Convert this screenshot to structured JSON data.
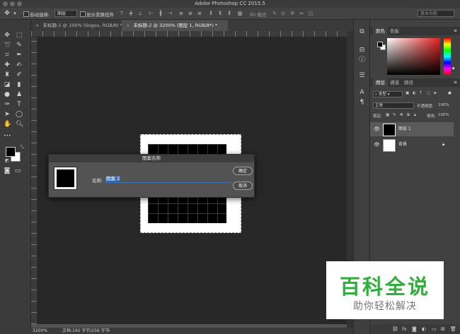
{
  "app": {
    "title": "Adobe Photoshop CC 2015.5"
  },
  "options_bar": {
    "auto_select_label": "自动选择:",
    "auto_select_value": "图层",
    "transform_label": "显示变换控件",
    "mode_3d_label": "3D 模式:",
    "search_placeholder": "基本功能"
  },
  "tabs": [
    {
      "label": "未标题-1 @ 100% (Sogou, RGB/8) *"
    },
    {
      "label": "未标题-2 @ 3200% (图层 1, RGB/8*) *"
    }
  ],
  "status_bar": {
    "zoom": "3200%",
    "doc_info": "文档:192 字节/256 字节"
  },
  "color_panel": {
    "tabs": [
      "颜色",
      "色板"
    ]
  },
  "layers_panel": {
    "tabs": [
      "图层",
      "通道",
      "路径"
    ],
    "filter_kind": "类型",
    "blend_mode": "正常",
    "opacity_label": "不透明度:",
    "opacity_value": "100%",
    "lock_label": "锁定:",
    "fill_label": "填充:",
    "fill_value": "100%",
    "layers": [
      {
        "name": "图层 1"
      },
      {
        "name": "背景"
      }
    ],
    "bottom_icons": [
      "link-icon",
      "fx-icon",
      "mask-icon",
      "adjustment-icon",
      "group-icon",
      "new-layer-icon",
      "trash-icon"
    ]
  },
  "dialog": {
    "title": "图案名称",
    "name_label": "名称:",
    "name_value": "图案 2",
    "ok_label": "确定",
    "cancel_label": "取消"
  },
  "watermark": {
    "title": "百科全说",
    "subtitle": "助你轻松解决"
  },
  "colors": {
    "foreground": "#000000",
    "background": "#ffffff",
    "watermark_green": "#2fae3a",
    "selection_highlight": "#3b6fb6"
  }
}
